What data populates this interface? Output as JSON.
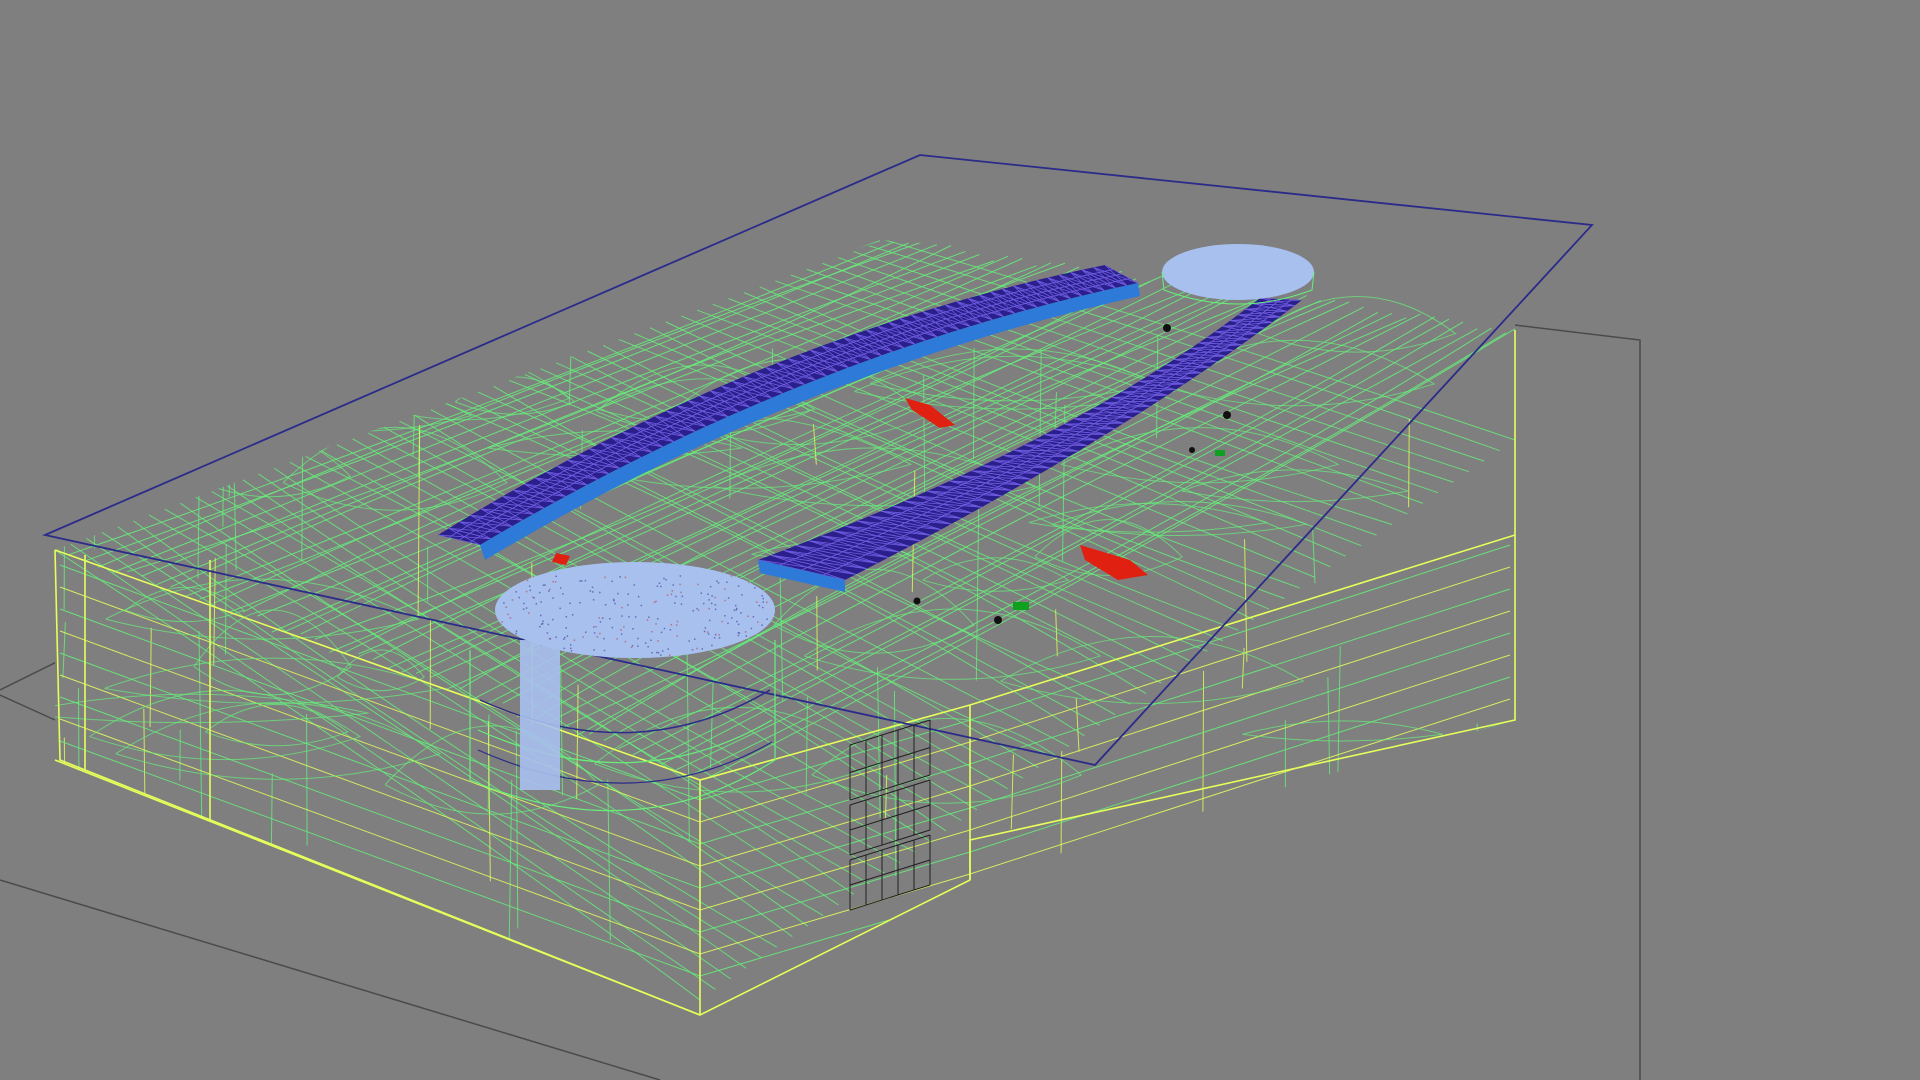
{
  "viewport": {
    "view_mode": "wireframe",
    "background_color": "#7f7f7f"
  },
  "colors": {
    "grid": "#4a4a4a",
    "selection_frame": "#2b2b8a",
    "wire_green": "#66f07a",
    "wire_yellow": "#e6ff5a",
    "roof_truss": "#22167a",
    "roof_fill": "#2a1f8c",
    "dome": "#a8c0ee",
    "highlight_red": "#e02010",
    "highlight_green": "#10a020",
    "markers": "#101010"
  },
  "scene": {
    "model": "building-wireframe",
    "elements": [
      "ground-plane",
      "selection-bounding-box",
      "building-shell",
      "curved-roof-truss-left",
      "curved-roof-truss-right",
      "dome-front",
      "dome-back",
      "front-windows",
      "interior-markers"
    ]
  }
}
